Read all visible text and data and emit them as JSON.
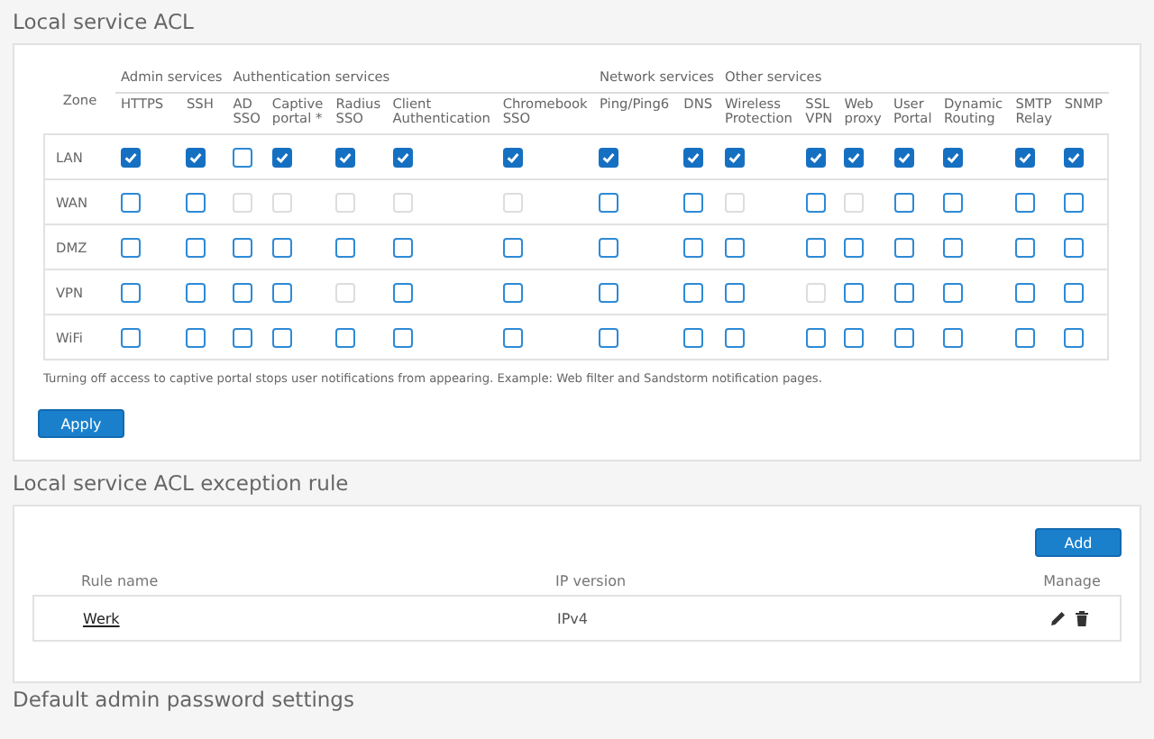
{
  "acl": {
    "title": "Local service ACL",
    "zone_header": "Zone",
    "groups": [
      {
        "label": "Admin services",
        "columns": [
          "HTTPS",
          "SSH"
        ]
      },
      {
        "label": "Authentication services",
        "columns": [
          "AD SSO",
          "Captive portal *",
          "Radius SSO",
          "Client Authentication",
          "Chromebook SSO"
        ]
      },
      {
        "label": "Network services",
        "columns": [
          "Ping/Ping6",
          "DNS"
        ]
      },
      {
        "label": "Other services",
        "columns": [
          "Wireless Protection",
          "SSL VPN",
          "Web proxy",
          "User Portal",
          "Dynamic Routing",
          "SMTP Relay",
          "SNMP"
        ]
      }
    ],
    "rows": [
      {
        "zone": "LAN",
        "cells": [
          {
            "checked": true,
            "disabled": false
          },
          {
            "checked": true,
            "disabled": false
          },
          {
            "checked": false,
            "disabled": false
          },
          {
            "checked": true,
            "disabled": false
          },
          {
            "checked": true,
            "disabled": false
          },
          {
            "checked": true,
            "disabled": false
          },
          {
            "checked": true,
            "disabled": false
          },
          {
            "checked": true,
            "disabled": false
          },
          {
            "checked": true,
            "disabled": false
          },
          {
            "checked": true,
            "disabled": false
          },
          {
            "checked": true,
            "disabled": false
          },
          {
            "checked": true,
            "disabled": false
          },
          {
            "checked": true,
            "disabled": false
          },
          {
            "checked": true,
            "disabled": false
          },
          {
            "checked": true,
            "disabled": false
          },
          {
            "checked": true,
            "disabled": false
          }
        ]
      },
      {
        "zone": "WAN",
        "cells": [
          {
            "checked": false,
            "disabled": false
          },
          {
            "checked": false,
            "disabled": false
          },
          {
            "checked": false,
            "disabled": true
          },
          {
            "checked": false,
            "disabled": true
          },
          {
            "checked": false,
            "disabled": true
          },
          {
            "checked": false,
            "disabled": true
          },
          {
            "checked": false,
            "disabled": true
          },
          {
            "checked": false,
            "disabled": false
          },
          {
            "checked": false,
            "disabled": false
          },
          {
            "checked": false,
            "disabled": true
          },
          {
            "checked": false,
            "disabled": false
          },
          {
            "checked": false,
            "disabled": true
          },
          {
            "checked": false,
            "disabled": false
          },
          {
            "checked": false,
            "disabled": false
          },
          {
            "checked": false,
            "disabled": false
          },
          {
            "checked": false,
            "disabled": false
          }
        ]
      },
      {
        "zone": "DMZ",
        "cells": [
          {
            "checked": false,
            "disabled": false
          },
          {
            "checked": false,
            "disabled": false
          },
          {
            "checked": false,
            "disabled": false
          },
          {
            "checked": false,
            "disabled": false
          },
          {
            "checked": false,
            "disabled": false
          },
          {
            "checked": false,
            "disabled": false
          },
          {
            "checked": false,
            "disabled": false
          },
          {
            "checked": false,
            "disabled": false
          },
          {
            "checked": false,
            "disabled": false
          },
          {
            "checked": false,
            "disabled": false
          },
          {
            "checked": false,
            "disabled": false
          },
          {
            "checked": false,
            "disabled": false
          },
          {
            "checked": false,
            "disabled": false
          },
          {
            "checked": false,
            "disabled": false
          },
          {
            "checked": false,
            "disabled": false
          },
          {
            "checked": false,
            "disabled": false
          }
        ]
      },
      {
        "zone": "VPN",
        "cells": [
          {
            "checked": false,
            "disabled": false
          },
          {
            "checked": false,
            "disabled": false
          },
          {
            "checked": false,
            "disabled": false
          },
          {
            "checked": false,
            "disabled": false
          },
          {
            "checked": false,
            "disabled": true
          },
          {
            "checked": false,
            "disabled": false
          },
          {
            "checked": false,
            "disabled": false
          },
          {
            "checked": false,
            "disabled": false
          },
          {
            "checked": false,
            "disabled": false
          },
          {
            "checked": false,
            "disabled": false
          },
          {
            "checked": false,
            "disabled": true
          },
          {
            "checked": false,
            "disabled": false
          },
          {
            "checked": false,
            "disabled": false
          },
          {
            "checked": false,
            "disabled": false
          },
          {
            "checked": false,
            "disabled": false
          },
          {
            "checked": false,
            "disabled": false
          }
        ]
      },
      {
        "zone": "WiFi",
        "cells": [
          {
            "checked": false,
            "disabled": false
          },
          {
            "checked": false,
            "disabled": false
          },
          {
            "checked": false,
            "disabled": false
          },
          {
            "checked": false,
            "disabled": false
          },
          {
            "checked": false,
            "disabled": false
          },
          {
            "checked": false,
            "disabled": false
          },
          {
            "checked": false,
            "disabled": false
          },
          {
            "checked": false,
            "disabled": false
          },
          {
            "checked": false,
            "disabled": false
          },
          {
            "checked": false,
            "disabled": false
          },
          {
            "checked": false,
            "disabled": false
          },
          {
            "checked": false,
            "disabled": false
          },
          {
            "checked": false,
            "disabled": false
          },
          {
            "checked": false,
            "disabled": false
          },
          {
            "checked": false,
            "disabled": false
          },
          {
            "checked": false,
            "disabled": false
          }
        ]
      }
    ],
    "note": "Turning off access to captive portal stops user notifications from appearing. Example: Web filter and Sandstorm notification pages.",
    "apply_button": "Apply"
  },
  "exceptions": {
    "title": "Local service ACL exception rule",
    "add_button": "Add",
    "columns": [
      "Rule name",
      "IP version",
      "Manage"
    ],
    "rows": [
      {
        "name": "Werk",
        "ip_version": "IPv4"
      }
    ]
  },
  "next_section": {
    "title": "Default admin password settings"
  }
}
